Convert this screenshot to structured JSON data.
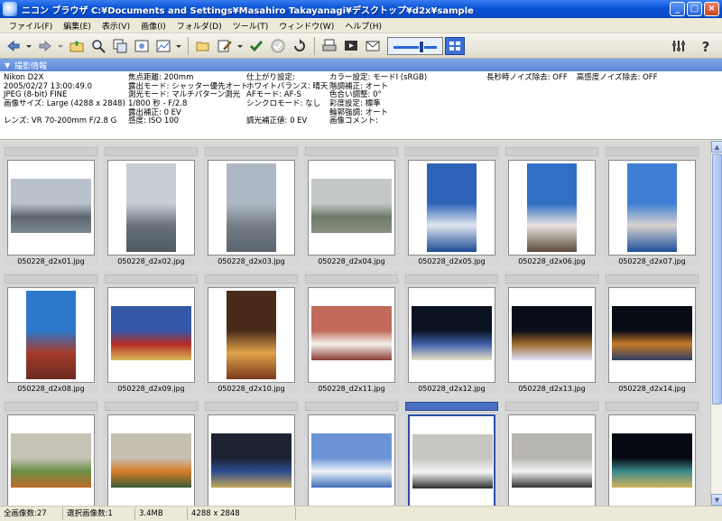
{
  "window": {
    "title": "ニコン ブラウザ C:¥Documents and Settings¥Masahiro Takayanagi¥デスクトップ¥d2x¥sample",
    "controls": [
      "_",
      "□",
      "×"
    ]
  },
  "menu": [
    "ファイル(F)",
    "編集(E)",
    "表示(V)",
    "画像(I)",
    "フォルダ(D)",
    "ツール(T)",
    "ウィンドウ(W)",
    "ヘルプ(H)"
  ],
  "toolbar": {
    "icons": [
      "back-icon",
      "forward-icon",
      "folder-up-icon",
      "search-icon",
      "adjust-icon",
      "print-preview-icon",
      "chart-icon",
      "open-folder-icon",
      "edit-icon",
      "check-icon",
      "check-circle-icon",
      "rotate-icon",
      "print-icon",
      "slideshow-icon",
      "mail-icon",
      "settings-icon",
      "help-icon"
    ],
    "thumbnail_size_level": 0.55
  },
  "section": {
    "label": "撮影情報"
  },
  "info": {
    "col1": [
      "Nikon D2X",
      "2005/02/27 13:00:49.0",
      "JPEG (8-bit) FINE",
      "画像サイズ: Large (4288 x 2848)",
      "",
      "レンズ: VR 70-200mm F/2.8 G"
    ],
    "col2": [
      "焦点距離: 200mm",
      "露出モード: シャッター優先オート",
      "測光モード: マルチパターン測光",
      "1/800 秒 - F/2.8",
      "露出補正: 0 EV",
      "感度: ISO 100"
    ],
    "col3": [
      "仕上がり設定:",
      "ホワイトバランス: 晴天",
      "AFモード: AF-S",
      "シンクロモード: なし",
      "",
      "調光補正値: 0 EV"
    ],
    "col4": [
      "カラー設定: モードI (sRGB)",
      "階調補正: オート",
      "色合い調整: 0°",
      "彩度設定: 標準",
      "輪郭強調: オート",
      "画像コメント:"
    ],
    "col5": [
      "長秒時ノイズ除去: OFF",
      "高感度ノイズ除去: OFF"
    ]
  },
  "thumbnails": [
    {
      "file": "050228_d2x01.jpg",
      "orientation": "landscape",
      "subject": "city-skyline-ferris-wheel",
      "colors": [
        "#b9c2cc",
        "#5d6670",
        "#7d8a91"
      ]
    },
    {
      "file": "050228_d2x02.jpg",
      "orientation": "portrait",
      "subject": "skyscrapers",
      "colors": [
        "#c7ced6",
        "#68717c",
        "#4f5a63"
      ]
    },
    {
      "file": "050228_d2x03.jpg",
      "orientation": "portrait",
      "subject": "landmark-tower",
      "colors": [
        "#aeb8c4",
        "#747d86",
        "#5a6470"
      ]
    },
    {
      "file": "050228_d2x04.jpg",
      "orientation": "landscape",
      "subject": "boats-harbor",
      "colors": [
        "#c4c9c7",
        "#6f7a6b",
        "#8a8f80"
      ]
    },
    {
      "file": "050228_d2x05.jpg",
      "orientation": "portrait",
      "subject": "tower-blue-sky",
      "colors": [
        "#2d64b8",
        "#dfe5ee",
        "#1c4a96"
      ]
    },
    {
      "file": "050228_d2x06.jpg",
      "orientation": "portrait",
      "subject": "sailing-ship",
      "colors": [
        "#2f6fc4",
        "#e9e4de",
        "#5a4b3c"
      ]
    },
    {
      "file": "050228_d2x07.jpg",
      "orientation": "portrait",
      "subject": "ferris-wheel",
      "colors": [
        "#3e7fd3",
        "#d7d2cf",
        "#1e4f9c"
      ]
    },
    {
      "file": "050228_d2x08.jpg",
      "orientation": "portrait",
      "subject": "red-brick-building",
      "colors": [
        "#2d77cc",
        "#a53d2b",
        "#6a2a20"
      ]
    },
    {
      "file": "050228_d2x09.jpg",
      "orientation": "landscape",
      "subject": "chinatown-gate",
      "colors": [
        "#3457a8",
        "#b52c24",
        "#d9b95a"
      ]
    },
    {
      "file": "050228_d2x10.jpg",
      "orientation": "portrait",
      "subject": "chandelier",
      "colors": [
        "#4a2a18",
        "#e0a34a",
        "#7a3b1c"
      ]
    },
    {
      "file": "050228_d2x11.jpg",
      "orientation": "landscape",
      "subject": "dessert-bowl",
      "colors": [
        "#c16a5c",
        "#f3f1ec",
        "#8b3f35"
      ]
    },
    {
      "file": "050228_d2x12.jpg",
      "orientation": "landscape",
      "subject": "bridge-night",
      "colors": [
        "#0b1220",
        "#3d5fa8",
        "#e8e2c8"
      ]
    },
    {
      "file": "050228_d2x13.jpg",
      "orientation": "landscape",
      "subject": "bridge-night-lights",
      "colors": [
        "#080d18",
        "#a06a2a",
        "#dde6ff"
      ]
    },
    {
      "file": "050228_d2x14.jpg",
      "orientation": "landscape",
      "subject": "city-night",
      "colors": [
        "#070b14",
        "#c77b2a",
        "#2f3e66"
      ]
    },
    {
      "file": "",
      "orientation": "landscape",
      "subject": "train",
      "colors": [
        "#c7c2b6",
        "#6a8f45",
        "#c06b2a"
      ]
    },
    {
      "file": "",
      "orientation": "landscape",
      "subject": "train",
      "colors": [
        "#c5c0b2",
        "#d87c2b",
        "#3a5a32"
      ]
    },
    {
      "file": "",
      "orientation": "landscape",
      "subject": "train-night",
      "colors": [
        "#1d2333",
        "#2b4c8f",
        "#c2a55a"
      ]
    },
    {
      "file": "",
      "orientation": "landscape",
      "subject": "airship",
      "colors": [
        "#6b93d6",
        "#eef2f7",
        "#3f6fb8"
      ]
    },
    {
      "file": "",
      "orientation": "landscape",
      "subject": "seagull",
      "colors": [
        "#c8c6c2",
        "#f6f6f6",
        "#2b2b2b"
      ],
      "selected": true
    },
    {
      "file": "",
      "orientation": "landscape",
      "subject": "seagull",
      "colors": [
        "#b7b5b0",
        "#f3f3f3",
        "#333333"
      ]
    },
    {
      "file": "",
      "orientation": "landscape",
      "subject": "city-night-skyline",
      "colors": [
        "#050912",
        "#3c8a8b",
        "#d0b25a"
      ]
    }
  ],
  "status": {
    "total": "全画像数:27",
    "selected": "選択画像数:1",
    "size": "3.4MB",
    "dimensions": "4288 x 2848"
  }
}
